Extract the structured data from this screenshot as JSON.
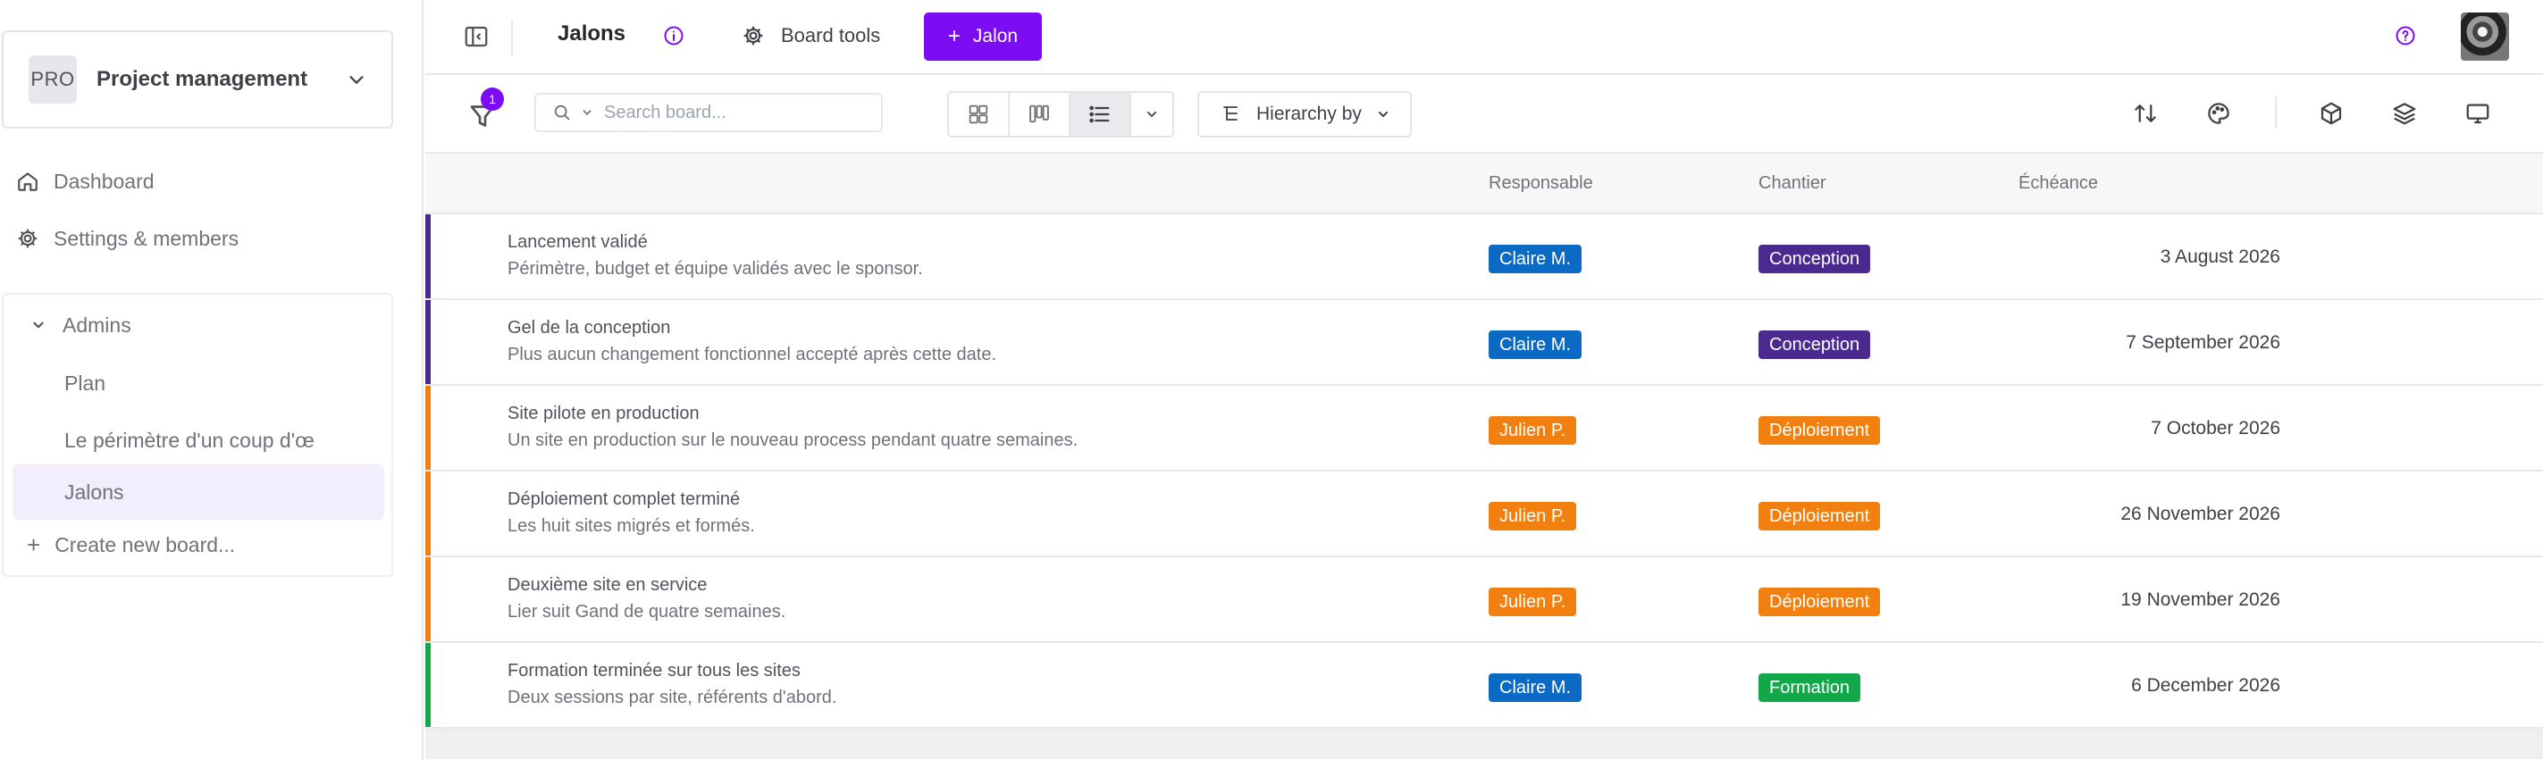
{
  "sidebar": {
    "project": {
      "badge": "PRO",
      "name": "Project management"
    },
    "nav": [
      {
        "label": "Dashboard",
        "icon": "home-icon"
      },
      {
        "label": "Settings & members",
        "icon": "gear-icon"
      }
    ],
    "group": {
      "label": "Admins"
    },
    "boards": [
      {
        "label": "Plan",
        "active": false
      },
      {
        "label": "Le périmètre d'un coup d'œ",
        "active": false
      },
      {
        "label": "Jalons",
        "active": true
      }
    ],
    "create_label": "Create new board..."
  },
  "topbar": {
    "title": "Jalons",
    "board_tools_label": "Board tools",
    "add_button_label": "Jalon"
  },
  "toolbar": {
    "filter_count": "1",
    "search_placeholder": "Search board...",
    "hierarchy_label": "Hierarchy by"
  },
  "table": {
    "columns": {
      "responsable": "Responsable",
      "chantier": "Chantier",
      "echeance": "Échéance"
    },
    "rows": [
      {
        "title": "Lancement validé",
        "desc": "Périmètre, budget et équipe validés avec le sponsor.",
        "owner": "Claire M.",
        "owner_color": "#0b6bc4",
        "chantier": "Conception",
        "chantier_color": "#4a2a8f",
        "bar_color": "#4a2a8f",
        "date": "3 August 2026"
      },
      {
        "title": "Gel de la conception",
        "desc": "Plus aucun changement fonctionnel accepté après cette date.",
        "owner": "Claire M.",
        "owner_color": "#0b6bc4",
        "chantier": "Conception",
        "chantier_color": "#4a2a8f",
        "bar_color": "#4a2a8f",
        "date": "7 September 2026"
      },
      {
        "title": "Site pilote en production",
        "desc": "Un site en production sur le nouveau process pendant quatre semaines.",
        "owner": "Julien P.",
        "owner_color": "#f28010",
        "chantier": "Déploiement",
        "chantier_color": "#f28010",
        "bar_color": "#f28010",
        "date": "7 October 2026"
      },
      {
        "title": "Déploiement complet terminé",
        "desc": "Les huit sites migrés et formés.",
        "owner": "Julien P.",
        "owner_color": "#f28010",
        "chantier": "Déploiement",
        "chantier_color": "#f28010",
        "bar_color": "#f28010",
        "date": "26 November 2026"
      },
      {
        "title": "Deuxième site en service",
        "desc": "Lier suit Gand de quatre semaines.",
        "owner": "Julien P.",
        "owner_color": "#f28010",
        "chantier": "Déploiement",
        "chantier_color": "#f28010",
        "bar_color": "#f28010",
        "date": "19 November 2026"
      },
      {
        "title": "Formation terminée sur tous les sites",
        "desc": "Deux sessions par site, référents d'abord.",
        "owner": "Claire M.",
        "owner_color": "#0b6bc4",
        "chantier": "Formation",
        "chantier_color": "#12a84a",
        "bar_color": "#12a84a",
        "date": "6 December 2026"
      }
    ]
  },
  "colors": {
    "accent": "#7c0df2",
    "active_board_bg": "#f3eefe"
  }
}
